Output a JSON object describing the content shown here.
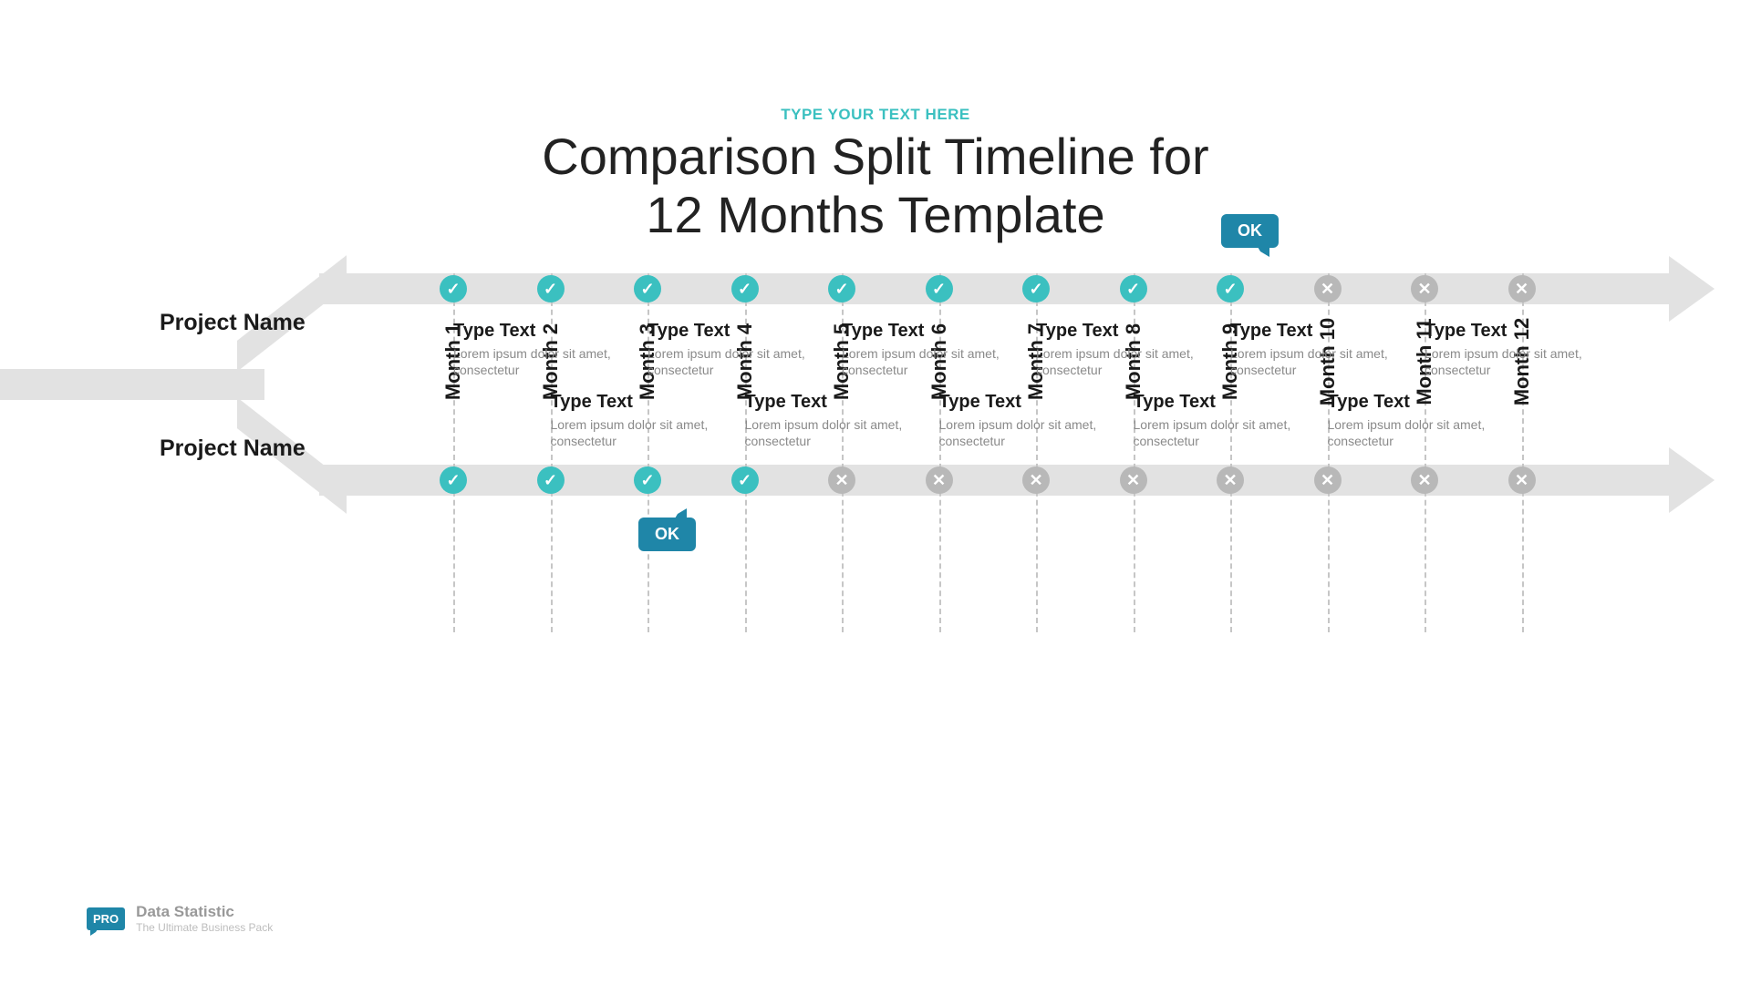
{
  "preheader": "TYPE YOUR TEXT HERE",
  "title_l1": "Comparison Split Timeline for",
  "title_l2": "12 Months Template",
  "project_top": "Project Name",
  "project_bottom": "Project Name",
  "bubble_top": "OK",
  "bubble_bottom": "OK",
  "months": [
    "Month 1",
    "Month 2",
    "Month 3",
    "Month 4",
    "Month 5",
    "Month 6",
    "Month 7",
    "Month 8",
    "Month 9",
    "Month 10",
    "Month 11",
    "Month 12"
  ],
  "status_top": [
    "check",
    "check",
    "check",
    "check",
    "check",
    "check",
    "check",
    "check",
    "check",
    "x",
    "x",
    "x"
  ],
  "status_bottom": [
    "check",
    "check",
    "check",
    "check",
    "x",
    "x",
    "x",
    "x",
    "x",
    "x",
    "x",
    "x"
  ],
  "bubble_top_month_index": 8,
  "bubble_bottom_month_index": 2,
  "blocks_top": [
    {
      "col": 0,
      "title": "Type Text",
      "body": "Lorem ipsum dolor sit amet, consectetur"
    },
    {
      "col": 2,
      "title": "Type Text",
      "body": "Lorem ipsum dolor sit amet, consectetur"
    },
    {
      "col": 4,
      "title": "Type Text",
      "body": "Lorem ipsum dolor sit amet, consectetur"
    },
    {
      "col": 6,
      "title": "Type Text",
      "body": "Lorem ipsum dolor sit amet, consectetur"
    },
    {
      "col": 8,
      "title": "Type Text",
      "body": "Lorem ipsum dolor sit amet, consectetur"
    },
    {
      "col": 10,
      "title": "Type Text",
      "body": "Lorem ipsum dolor sit amet, consectetur"
    }
  ],
  "blocks_bottom": [
    {
      "col": 1,
      "title": "Type Text",
      "body": "Lorem ipsum dolor sit amet, consectetur"
    },
    {
      "col": 3,
      "title": "Type Text",
      "body": "Lorem ipsum dolor sit amet, consectetur"
    },
    {
      "col": 5,
      "title": "Type Text",
      "body": "Lorem ipsum dolor sit amet, consectetur"
    },
    {
      "col": 7,
      "title": "Type Text",
      "body": "Lorem ipsum dolor sit amet, consectetur"
    },
    {
      "col": 9,
      "title": "Type Text",
      "body": "Lorem ipsum dolor sit amet, consectetur"
    }
  ],
  "footer": {
    "badge": "PRO",
    "title": "Data Statistic",
    "sub": "The Ultimate Business Pack"
  },
  "colors": {
    "accent": "#3bc0c0",
    "bubble": "#1f86a8",
    "bar": "#e2e2e2",
    "muted": "#b8b8b8"
  }
}
